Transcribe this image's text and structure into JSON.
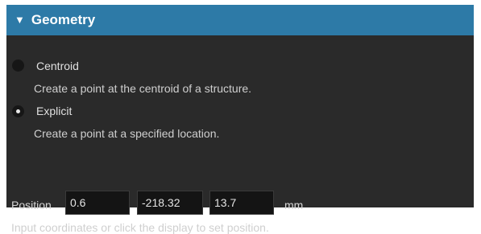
{
  "section": {
    "title": "Geometry"
  },
  "options": [
    {
      "label": "Centroid",
      "description": "Create a point at the centroid of a structure.",
      "selected": false
    },
    {
      "label": "Explicit",
      "description": "Create a point at a specified location.",
      "selected": true
    }
  ],
  "position": {
    "label": "Position",
    "x": "0.6",
    "y": "-218.32",
    "z": "13.7",
    "unit": "mm",
    "hint": "Input coordinates or click the display to set position."
  },
  "colors": {
    "header": "#2d7aa7",
    "panel": "#2a2a2a",
    "field": "#141414"
  }
}
